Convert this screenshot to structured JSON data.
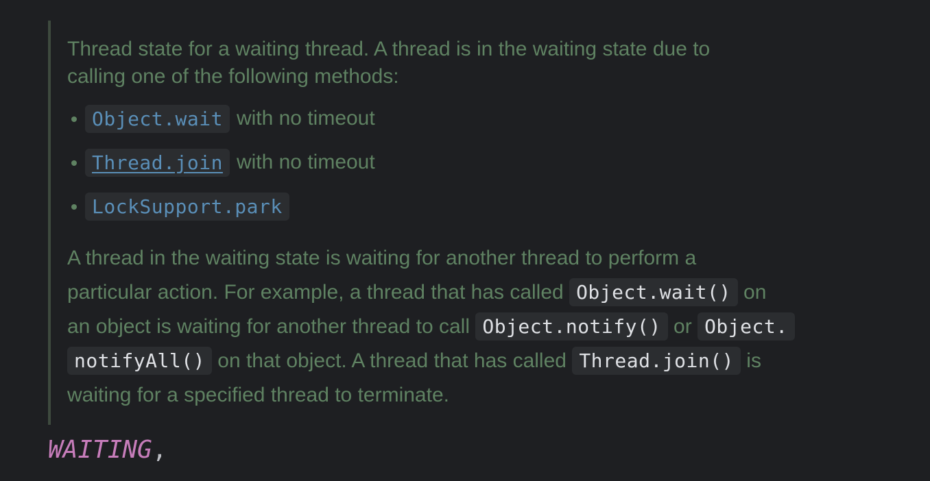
{
  "doc": {
    "intro_line1": "Thread state for a waiting thread. A thread is in the waiting state due to",
    "intro_line2": "calling one of the following methods:",
    "methods": [
      {
        "code": "Object.wait",
        "suffix": "with no timeout"
      },
      {
        "code": "Thread.join",
        "suffix": "with no timeout"
      },
      {
        "code": "LockSupport.park",
        "suffix": ""
      }
    ],
    "para": {
      "l1": "A thread in the waiting state is waiting for another thread to perform a",
      "l2_a": "particular action. For example, a thread that has called ",
      "l2_code": "Object.wait()",
      "l2_b": " on",
      "l3_a": "an object is waiting for another thread to call ",
      "l3_code1": "Object.notify()",
      "l3_b": " or ",
      "l3_code2": "Object.",
      "l4_code1": "notifyAll()",
      "l4_a": " on that object. A thread that has called ",
      "l4_code2": "Thread.join()",
      "l4_b": " is",
      "l5": "waiting for a specified thread to terminate."
    }
  },
  "code": {
    "enum_name": "WAITING",
    "comma": ","
  },
  "colors": {
    "background": "#1e1f22",
    "doc_text": "#5f8262",
    "link": "#5a8fb8",
    "enum": "#c77dbb"
  }
}
